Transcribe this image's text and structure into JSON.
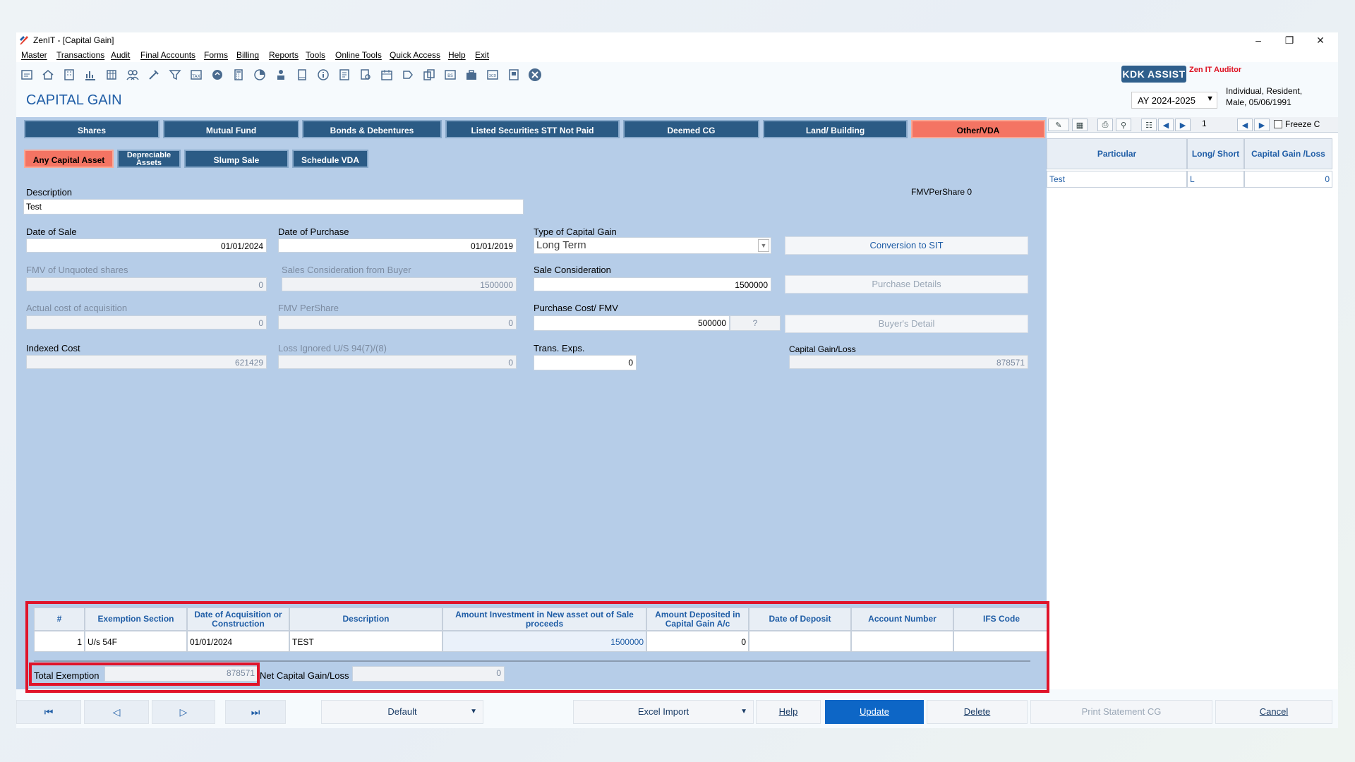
{
  "window": {
    "title": "ZenIT - [Capital Gain]"
  },
  "menu": [
    "Master",
    "Transactions",
    "Audit",
    "Final Accounts",
    "Forms",
    "Billing",
    "Reports",
    "Tools",
    "Online Tools",
    "Quick Access",
    "Help",
    "Exit"
  ],
  "header": {
    "kdk_label": "KDK ASSIST",
    "zen_auditor": "Zen IT Auditor",
    "page_title": "CAPITAL GAIN",
    "assessment_year": "AY 2024-2025",
    "profile_line1": "Individual, Resident,",
    "profile_line2": "Male, 05/06/1991"
  },
  "tabs": [
    "Shares",
    "Mutual Fund",
    "Bonds & Debentures",
    "Listed Securities STT Not Paid",
    "Deemed CG",
    "Land/ Building",
    "Other/VDA"
  ],
  "active_tab": "Other/VDA",
  "subtabs": [
    "Any Capital Asset",
    "Depreciable Assets",
    "Slump Sale",
    "Schedule VDA"
  ],
  "form": {
    "description_label": "Description",
    "description_value": "Test",
    "fmv_per_share_top": "FMVPerShare 0",
    "date_of_sale_label": "Date of Sale",
    "date_of_sale": "01/01/2024",
    "date_of_purchase_label": "Date of Purchase",
    "date_of_purchase": "01/01/2019",
    "type_cg_label": "Type of Capital Gain",
    "type_cg": "Long Term",
    "conversion_btn": "Conversion to SIT",
    "fmv_unquoted_label": "FMV of Unquoted shares",
    "fmv_unquoted": "0",
    "sales_consideration_buyer_label": "Sales Consideration from Buyer",
    "sales_consideration_buyer": "1500000",
    "sale_consideration_label": "Sale Consideration",
    "sale_consideration": "1500000",
    "purchase_details_btn": "Purchase Details",
    "actual_cost_label": "Actual cost of acquisition",
    "actual_cost": "0",
    "fmv_pershare_label": "FMV PerShare",
    "fmv_pershare": "0",
    "purchase_cost_label": "Purchase Cost/ FMV",
    "purchase_cost": "500000",
    "purchase_cost_helper": "?",
    "buyers_detail_btn": "Buyer's Detail",
    "indexed_cost_label": "Indexed Cost",
    "indexed_cost": "621429",
    "loss_ignored_label": "Loss Ignored U/S 94(7)/(8)",
    "loss_ignored": "0",
    "trans_exps_label": "Trans. Exps.",
    "trans_exps": "0",
    "capital_gain_loss_label": "Capital Gain/Loss",
    "capital_gain_loss": "878571"
  },
  "right_panel": {
    "page_no": "1",
    "freeze_label": "Freeze C",
    "columns": [
      "Particular",
      "Long/ Short",
      "Capital Gain /Loss"
    ],
    "rows": [
      {
        "particular": "Test",
        "long_short": "L",
        "gain": "0"
      }
    ]
  },
  "exemption_grid": {
    "columns": [
      "#",
      "Exemption Section",
      "Date of Acquisition or Construction",
      "Description",
      "Amount Investment in New asset out of Sale proceeds",
      "Amount Deposited in Capital Gain A/c",
      "Date of Deposit",
      "Account Number",
      "IFS Code"
    ],
    "rows": [
      {
        "no": "1",
        "section": "U/s 54F",
        "date": "01/01/2024",
        "description": "TEST",
        "amount_invested": "1500000",
        "amount_deposited": "0",
        "date_of_deposit": "",
        "account_number": "",
        "ifs_code": ""
      }
    ],
    "total_exemption_label": "Total Exemption",
    "total_exemption": "878571",
    "net_cg_label": "Net Capital Gain/Loss",
    "net_cg": "0"
  },
  "bottom": {
    "default_select": "Default",
    "excel_import": "Excel Import",
    "help": "Help",
    "update": "Update",
    "delete": "Delete",
    "print_statement": "Print Statement CG",
    "cancel": "Cancel"
  },
  "colors": {
    "main_bg": "#b6cde8",
    "tab_bg": "#2b5b85",
    "active_tab_bg": "#f47463",
    "accent_blue": "#1f5da6",
    "highlight_red": "#e0142a"
  }
}
